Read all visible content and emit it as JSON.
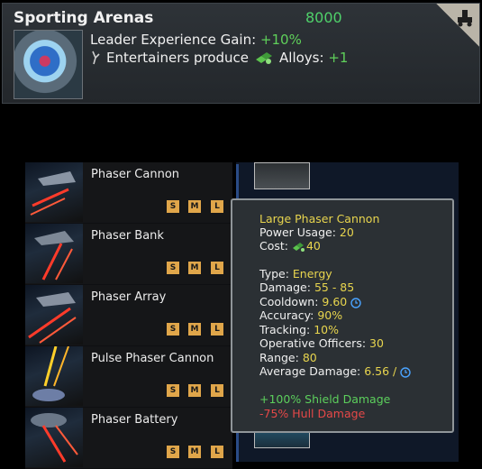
{
  "card": {
    "title": "Sporting Arenas",
    "cost": "8000",
    "line1_label": "Leader Experience Gain: ",
    "line1_value": "+10%",
    "line2_label": "Entertainers produce",
    "line2_resource": "Alloys: ",
    "line2_value": "+1",
    "corner_icon": "building-category-icon"
  },
  "weapons": [
    {
      "name": "Phaser Cannon",
      "sizes": [
        "S",
        "M",
        "L"
      ]
    },
    {
      "name": "Phaser Bank",
      "sizes": [
        "S",
        "M",
        "L"
      ]
    },
    {
      "name": "Phaser Array",
      "sizes": [
        "S",
        "M",
        "L"
      ]
    },
    {
      "name": "Pulse Phaser Cannon",
      "sizes": [
        "S",
        "M",
        "L"
      ]
    },
    {
      "name": "Phaser Battery",
      "sizes": [
        "S",
        "M",
        "L"
      ]
    }
  ],
  "tooltip": {
    "title": "Large Phaser Cannon",
    "power_label": "Power Usage: ",
    "power_value": "20",
    "cost_label": "Cost: ",
    "cost_value": "40",
    "type_label": "Type: ",
    "type_value": "Energy",
    "damage_label": "Damage: ",
    "damage_value": "55 - 85",
    "cooldown_label": "Cooldown: ",
    "cooldown_value": "9.60",
    "accuracy_label": "Accuracy: ",
    "accuracy_value": "90%",
    "tracking_label": "Tracking: ",
    "tracking_value": "10%",
    "officers_label": "Operative Officers: ",
    "officers_value": "30",
    "range_label": "Range: ",
    "range_value": "80",
    "avg_label": "Average Damage: ",
    "avg_value": "6.56 /",
    "bonus_shield": "+100% Shield Damage",
    "bonus_hull": "-75% Hull Damage"
  },
  "colors": {
    "positive": "#5fd05a",
    "negative": "#e64848",
    "highlight": "#e8d54e",
    "size_badge": "#e0a64a"
  }
}
